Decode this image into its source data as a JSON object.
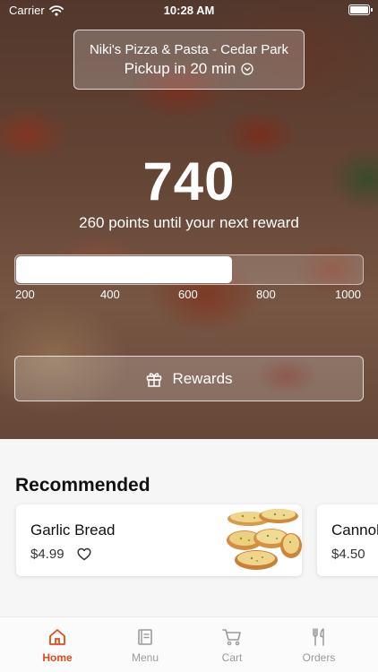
{
  "status_bar": {
    "carrier": "Carrier",
    "time": "10:28 AM"
  },
  "store": {
    "name": "Niki's Pizza & Pasta - Cedar Park",
    "pickup": "Pickup in 20 min"
  },
  "points": {
    "value": "740",
    "message": "260 points until your next reward",
    "progress_fraction": 0.625
  },
  "progress_ticks": [
    "200",
    "400",
    "600",
    "800",
    "1000"
  ],
  "rewards_button": {
    "label": "Rewards"
  },
  "recommended": {
    "title": "Recommended",
    "items": [
      {
        "name": "Garlic Bread",
        "price": "$4.99"
      },
      {
        "name": "Cannoli",
        "price": "$4.50"
      }
    ]
  },
  "tab_bar": {
    "items": [
      {
        "label": "Home",
        "icon": "home-icon",
        "active": true
      },
      {
        "label": "Menu",
        "icon": "menu-icon",
        "active": false
      },
      {
        "label": "Cart",
        "icon": "cart-icon",
        "active": false
      },
      {
        "label": "Orders",
        "icon": "orders-icon",
        "active": false
      }
    ]
  },
  "colors": {
    "accent": "#e24a18"
  }
}
